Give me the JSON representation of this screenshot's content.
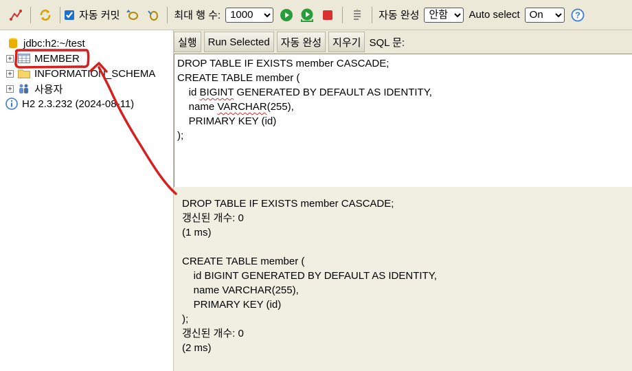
{
  "toolbar": {
    "autocommit_label": "자동 커밋",
    "autocommit_checked": true,
    "max_rows_label": "최대 행 수:",
    "max_rows_value": "1000",
    "autocomplete_label": "자동 완성",
    "autocomplete_value": "안함",
    "autoselect_label": "Auto select",
    "autoselect_value": "On",
    "icons": [
      "disconnect-icon",
      "refresh-icon",
      "rollback-icon",
      "commit-icon",
      "run-icon",
      "run-selected-icon",
      "stop-icon",
      "history-icon",
      "help-icon"
    ]
  },
  "tree": {
    "connection": "jdbc:h2:~/test",
    "items": [
      {
        "label": "MEMBER",
        "icon": "table-icon"
      },
      {
        "label": "INFORMATION_SCHEMA",
        "icon": "folder-icon"
      },
      {
        "label": "사용자",
        "icon": "users-icon"
      }
    ],
    "version": "H2 2.3.232 (2024-08-11)"
  },
  "buttons": {
    "run": "실행",
    "run_selected": "Run Selected",
    "autocomplete": "자동 완성",
    "clear": "지우기",
    "sql_label": "SQL 문:"
  },
  "editor": {
    "line1": "DROP TABLE IF EXISTS member CASCADE;",
    "line2": "CREATE TABLE member (",
    "line3_a": "    id ",
    "line3_b": "BIGINT",
    "line3_c": " GENERATED BY DEFAULT AS IDENTITY,",
    "line4_a": "    name ",
    "line4_b": "VARCHAR",
    "line4_c": "(255),",
    "line5": "    PRIMARY KEY (id)",
    "line6": ");"
  },
  "results": {
    "lines": [
      "DROP TABLE IF EXISTS member CASCADE;",
      "갱신된 개수: 0",
      "(1 ms)",
      "",
      "CREATE TABLE member (",
      "    id BIGINT GENERATED BY DEFAULT AS IDENTITY,",
      "    name VARCHAR(255),",
      "    PRIMARY KEY (id)",
      ");",
      "갱신된 개수: 0",
      "(2 ms)"
    ]
  },
  "colors": {
    "annotation": "#d61f1f",
    "panel": "#ece9d8",
    "results_bg": "#f0efe2"
  }
}
